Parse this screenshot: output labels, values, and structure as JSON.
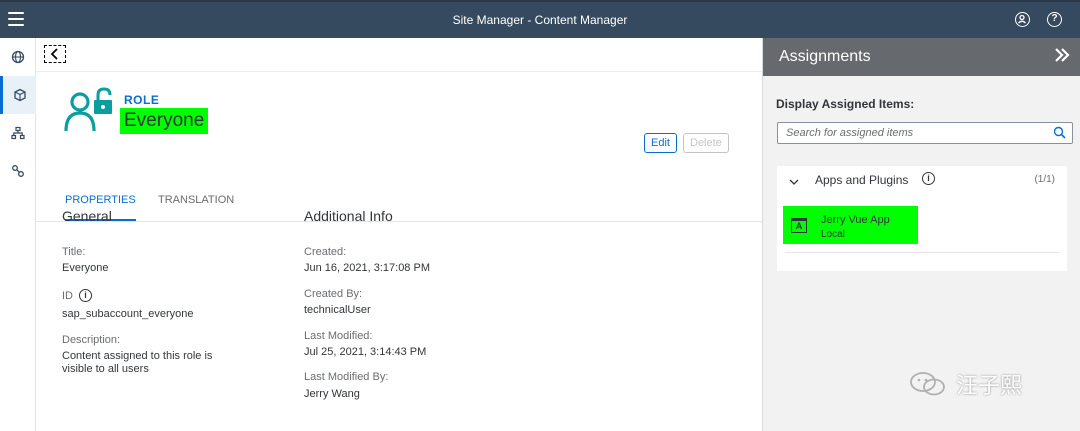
{
  "shell": {
    "title": "Site Manager - Content Manager",
    "profile_icon": "user-circle-icon",
    "help_icon": "question-icon",
    "help_glyph": "?"
  },
  "rail": {
    "items": [
      {
        "icon": "globe-icon"
      },
      {
        "icon": "package-icon",
        "active": true
      },
      {
        "icon": "sitemap-icon"
      },
      {
        "icon": "connection-icon"
      }
    ]
  },
  "role": {
    "label": "ROLE",
    "name": "Everyone",
    "edit_label": "Edit",
    "delete_label": "Delete"
  },
  "tabs": [
    "PROPERTIES",
    "TRANSLATION"
  ],
  "general": {
    "title": "General",
    "title_label": "Title:",
    "title_value": "Everyone",
    "id_label": "ID",
    "id_value": "sap_subaccount_everyone",
    "description_label": "Description:",
    "description_value_line1": "Content assigned to this role is",
    "description_value_line2": "visible to all users"
  },
  "additional": {
    "title": "Additional Info",
    "created_label": "Created:",
    "created_value": "Jun 16, 2021, 3:17:08 PM",
    "created_by_label": "Created By:",
    "created_by_value": "technicalUser",
    "last_modified_label": "Last Modified:",
    "last_modified_value": "Jul 25, 2021, 3:14:43 PM",
    "last_modified_by_label": "Last Modified By:",
    "last_modified_by_value": "Jerry Wang"
  },
  "assignments": {
    "title": "Assignments",
    "display_label": "Display Assigned Items:",
    "search_placeholder": "Search for assigned items",
    "group_name": "Apps and Plugins",
    "group_count": "(1/1)",
    "info_glyph": "i",
    "app_glyph": "A",
    "app_name": "Jerry Vue App",
    "app_scope": "Local"
  },
  "watermark": {
    "text": "汪子熙"
  },
  "colors": {
    "shell": "#354a5f",
    "accent": "#0a6ed1",
    "highlight": "#00ff00",
    "panel_header": "#666a6e"
  }
}
